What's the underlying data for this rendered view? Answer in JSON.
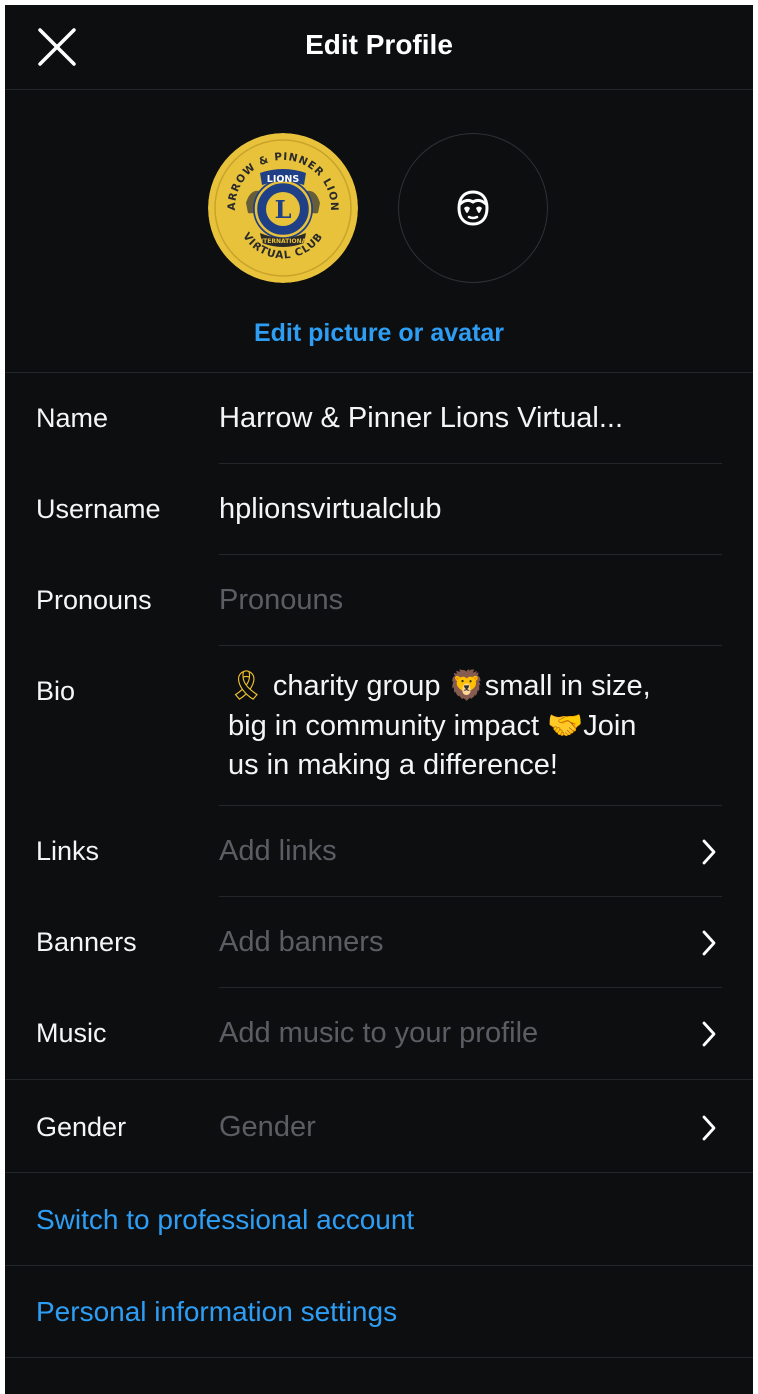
{
  "header": {
    "title": "Edit Profile"
  },
  "avatar_section": {
    "profile_picture_text": {
      "top_arc": "HARROW & PINNER LIONS",
      "brand": "LIONS",
      "letter": "L",
      "ribbon": "INTERNATIONAL",
      "bottom_arc": "VIRTUAL CLUB"
    },
    "edit_link": "Edit picture or avatar"
  },
  "fields": {
    "name": {
      "label": "Name",
      "value": "Harrow & Pinner Lions Virtual..."
    },
    "username": {
      "label": "Username",
      "value": "hplionsvirtualclub"
    },
    "pronouns": {
      "label": "Pronouns",
      "placeholder": "Pronouns"
    },
    "bio": {
      "label": "Bio",
      "line1": "charity group",
      "line1b": "small in size,",
      "line2": "big in community impact",
      "line2b": "Join",
      "line3": "us in making a difference!",
      "emoji_ribbon": "🎗",
      "emoji_lion": "🦁",
      "emoji_handshake": "🤝"
    },
    "links": {
      "label": "Links",
      "placeholder": "Add links"
    },
    "banners": {
      "label": "Banners",
      "placeholder": "Add banners"
    },
    "music": {
      "label": "Music",
      "placeholder": "Add music to your profile"
    },
    "gender": {
      "label": "Gender",
      "placeholder": "Gender"
    }
  },
  "actions": {
    "switch_professional": "Switch to professional account",
    "personal_info": "Personal information settings"
  },
  "colors": {
    "background": "#0d0e10",
    "accent_blue": "#2e9ef5",
    "logo_gold": "#e8c23a",
    "logo_navy": "#1f3f86"
  }
}
